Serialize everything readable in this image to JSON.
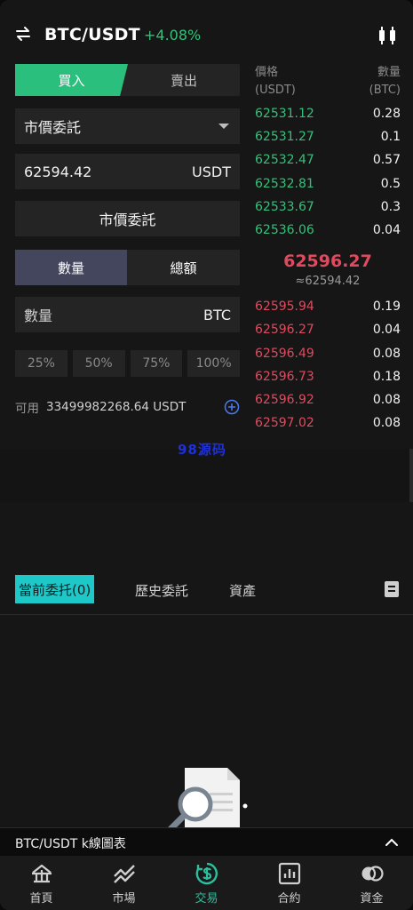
{
  "header": {
    "pair": "BTC/USDT",
    "change": "+4.08%"
  },
  "form": {
    "buy_label": "買入",
    "sell_label": "賣出",
    "order_type": "市價委託",
    "price_value": "62594.42",
    "price_unit": "USDT",
    "market_button": "市價委託",
    "qty_tab": "數量",
    "total_tab": "總額",
    "qty_placeholder": "數量",
    "qty_unit": "BTC",
    "percents": [
      "25%",
      "50%",
      "75%",
      "100%"
    ],
    "available_label": "可用",
    "available_value": "33499982268.64 USDT"
  },
  "orderbook": {
    "price_header": "價格",
    "price_unit": "(USDT)",
    "qty_header": "數量",
    "qty_unit": "(BTC)",
    "bids": [
      {
        "price": "62531.12",
        "qty": "0.28"
      },
      {
        "price": "62531.27",
        "qty": "0.1"
      },
      {
        "price": "62532.47",
        "qty": "0.57"
      },
      {
        "price": "62532.81",
        "qty": "0.5"
      },
      {
        "price": "62533.67",
        "qty": "0.3"
      },
      {
        "price": "62536.06",
        "qty": "0.04"
      }
    ],
    "last_price": "62596.27",
    "approx_price": "≈62594.42",
    "asks": [
      {
        "price": "62595.94",
        "qty": "0.19"
      },
      {
        "price": "62596.27",
        "qty": "0.04"
      },
      {
        "price": "62596.49",
        "qty": "0.08"
      },
      {
        "price": "62596.73",
        "qty": "0.18"
      },
      {
        "price": "62596.92",
        "qty": "0.08"
      },
      {
        "price": "62597.02",
        "qty": "0.08"
      }
    ]
  },
  "watermark": "98源码",
  "orders": {
    "tabs": [
      "當前委托(0)",
      "歷史委託",
      "資產"
    ]
  },
  "kline_bar": {
    "title": "BTC/USDT k線圖表"
  },
  "nav": {
    "items": [
      {
        "label": "首頁",
        "icon": "home-icon"
      },
      {
        "label": "市場",
        "icon": "market-chart-icon"
      },
      {
        "label": "交易",
        "icon": "trade-dollar-icon"
      },
      {
        "label": "合約",
        "icon": "contract-bar-icon"
      },
      {
        "label": "資金",
        "icon": "funds-coins-icon"
      }
    ],
    "active": "交易"
  },
  "colors": {
    "accent_green": "#2bbf7e",
    "bid_green": "#35c07a",
    "ask_red": "#e04a5f",
    "tab_cyan": "#1fc8c8",
    "nav_active": "#2bbf9e"
  }
}
